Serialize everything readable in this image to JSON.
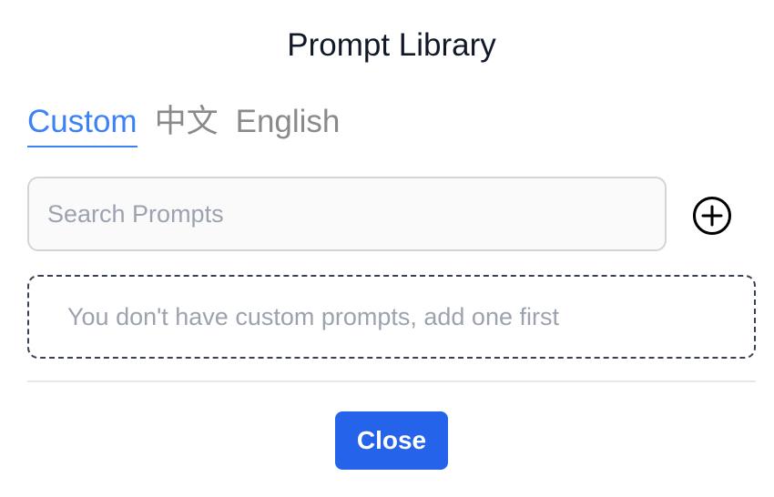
{
  "dialog": {
    "title": "Prompt Library"
  },
  "tabs": [
    {
      "label": "Custom",
      "active": true
    },
    {
      "label": "中文",
      "active": false
    },
    {
      "label": "English",
      "active": false
    }
  ],
  "search": {
    "placeholder": "Search Prompts",
    "value": ""
  },
  "add_button": {
    "icon": "plus-circle-icon"
  },
  "empty_state": {
    "message": "You don't have custom prompts, add one first"
  },
  "footer": {
    "close_label": "Close"
  },
  "colors": {
    "accent": "#3b82f6",
    "primary_button": "#2563eb",
    "inactive_tab": "#8a8a8a",
    "muted_text": "#9ca3af",
    "title_text": "#111827"
  }
}
